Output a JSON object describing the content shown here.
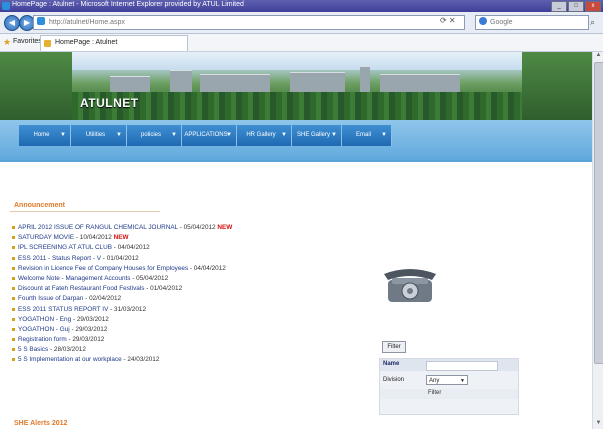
{
  "window": {
    "title": "HomePage : Atulnet - Microsoft Internet Explorer provided by ATUL Limited",
    "buttons": [
      "_",
      "□",
      "x"
    ]
  },
  "addressbar": {
    "url": "http://atulnet/Home.aspx",
    "search_placeholder": "Google"
  },
  "favorites": {
    "label": "Favorites",
    "tab_title": "HomePage : Atulnet"
  },
  "site": {
    "logo": "ATULNET",
    "nav": [
      {
        "label": "Home"
      },
      {
        "label": "Utilities"
      },
      {
        "label": "policies"
      },
      {
        "label": "APPLICATIONS"
      },
      {
        "label": "HR Gallery"
      },
      {
        "label": "SHE Gallery"
      },
      {
        "label": "Email"
      }
    ]
  },
  "announcement": {
    "heading": "Announcement",
    "items": [
      {
        "text": "APRIL 2012 ISSUE OF RANGUL CHEMICAL JOURNAL",
        "date": "05/04/2012",
        "new": "NEW"
      },
      {
        "text": "SATURDAY MOVIE",
        "date": "10/04/2012",
        "new": "NEW"
      },
      {
        "text": "IPL SCREENING AT ATUL CLUB",
        "date": "04/04/2012",
        "new": ""
      },
      {
        "text": "ESS 2011 - Status Report - V",
        "date": "01/04/2012",
        "new": ""
      },
      {
        "text": "Revision in Licence Fee of Company Houses for Employees",
        "date": "04/04/2012",
        "new": ""
      },
      {
        "text": "Welcome Note - Management Accounts",
        "date": "05/04/2012",
        "new": ""
      },
      {
        "text": "Discount at Fateh Restaurant Food Festivals",
        "date": "01/04/2012",
        "new": ""
      },
      {
        "text": "Fourth Issue of Darpan",
        "date": "02/04/2012",
        "new": ""
      },
      {
        "text": "ESS 2011 STATUS REPORT IV",
        "date": "31/03/2012",
        "new": ""
      },
      {
        "text": "YOGATHON - Eng",
        "date": "29/03/2012",
        "new": ""
      },
      {
        "text": "YOGATHON - Guj",
        "date": "29/03/2012",
        "new": ""
      },
      {
        "text": "Registration form",
        "date": "29/03/2012",
        "new": ""
      },
      {
        "text": "5 S Basics",
        "date": "28/03/2012",
        "new": ""
      },
      {
        "text": "5 S Implementation at our workplace",
        "date": "24/03/2012",
        "new": ""
      }
    ]
  },
  "filter": {
    "button": "Filter",
    "name_label": "Name",
    "division_label": "Division",
    "division_value": "Any",
    "filter_link": "Filter"
  },
  "footer_heading": "SHE Alerts 2012"
}
